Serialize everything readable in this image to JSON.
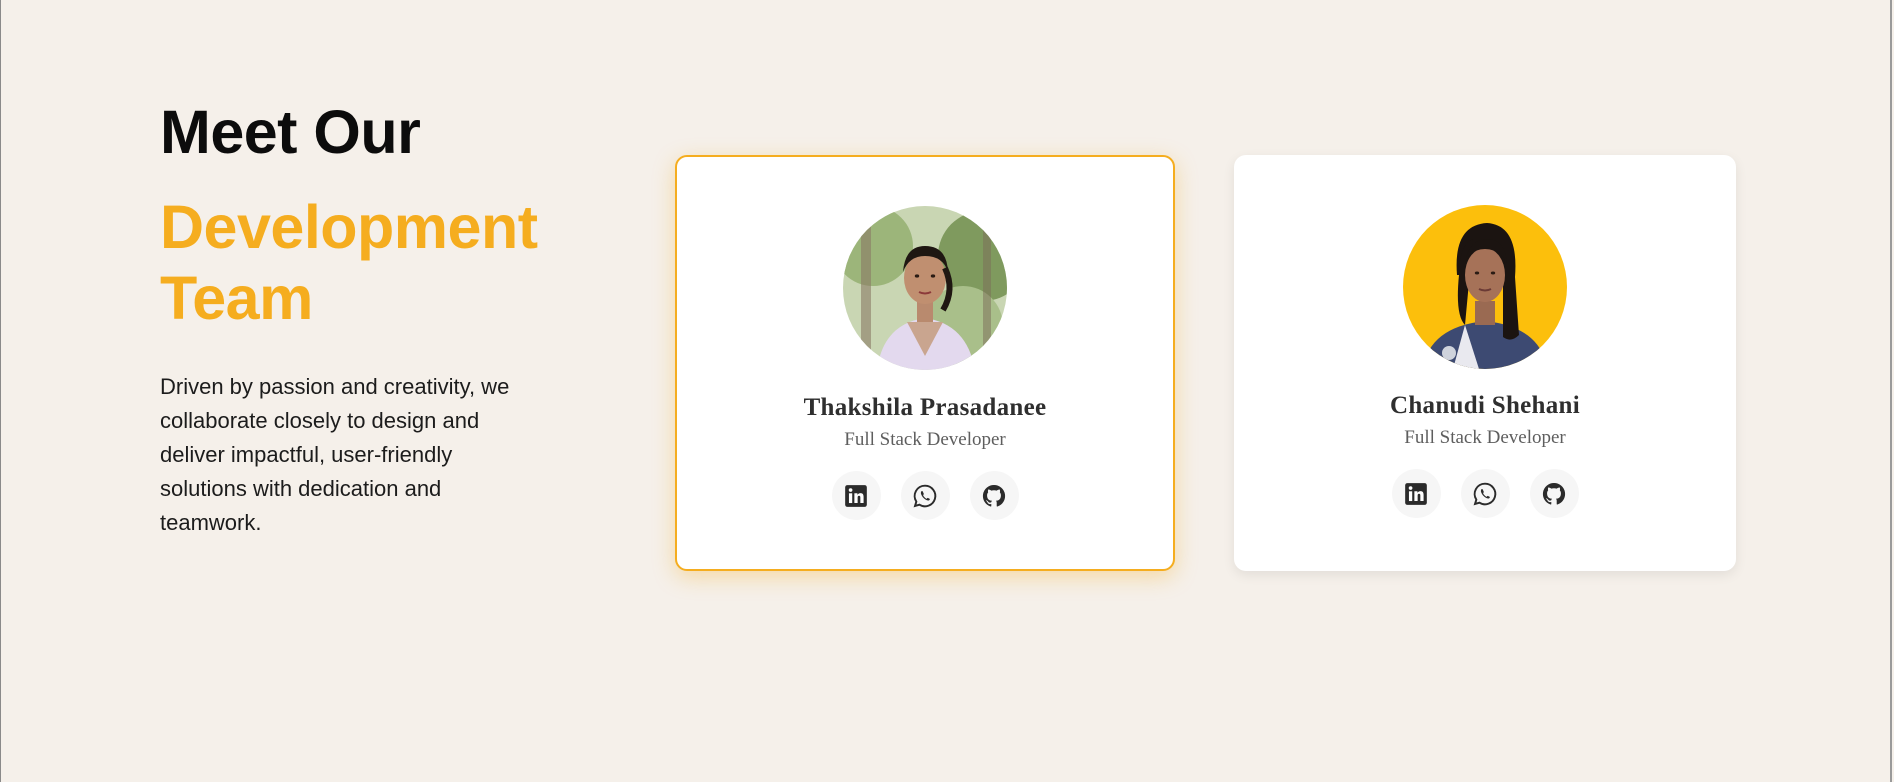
{
  "intro": {
    "heading_line1": "Meet Our",
    "heading_line2": "Development Team",
    "description": "Driven by passion and creativity, we collaborate closely to design and deliver impactful, user-friendly solutions with dedication and teamwork."
  },
  "members": [
    {
      "name": "Thakshila Prasadanee",
      "role": "Full Stack Developer",
      "highlighted": true,
      "avatar_background": "#8fa66f",
      "socials": [
        "linkedin-icon",
        "whatsapp-icon",
        "github-icon"
      ]
    },
    {
      "name": "Chanudi Shehani",
      "role": "Full Stack Developer",
      "highlighted": false,
      "avatar_background": "#fcbf0c",
      "socials": [
        "linkedin-icon",
        "whatsapp-icon",
        "github-icon"
      ]
    }
  ],
  "colors": {
    "page_background": "#f5f0ea",
    "accent": "#f5ad1f",
    "heading": "#0c0c0c",
    "card_background": "#ffffff",
    "icon": "#2b2b2b"
  }
}
